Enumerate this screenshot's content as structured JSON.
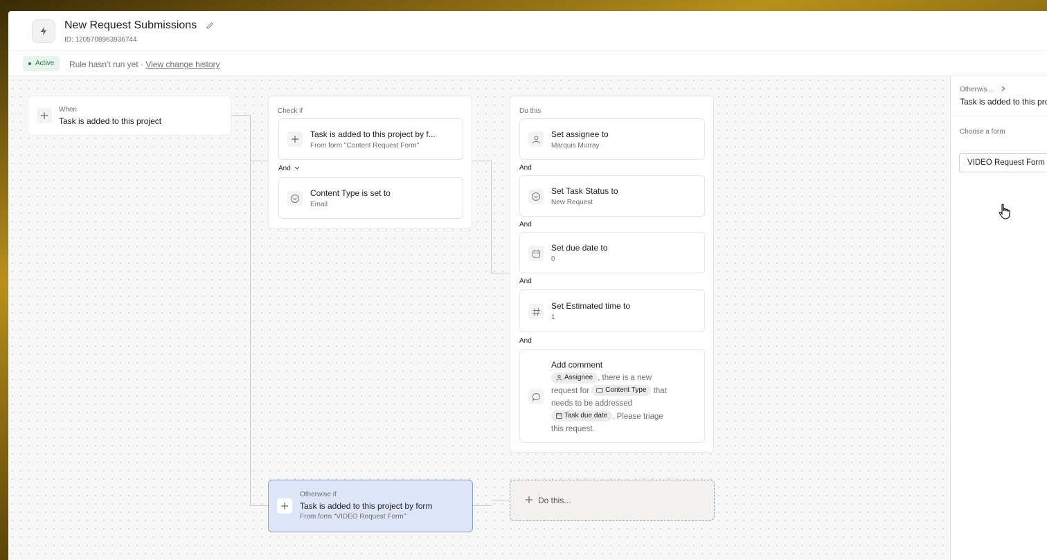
{
  "header": {
    "title": "New Request Submissions",
    "id_text": "ID: 1205708963936744"
  },
  "status": {
    "badge": "Active",
    "run_text": "Rule hasn't run yet · ",
    "history_link": "View change history"
  },
  "when": {
    "label": "When",
    "trigger": "Task is added to this project"
  },
  "check_if": {
    "label": "Check if",
    "conditions": [
      {
        "title": "Task is added to this project by f...",
        "subtitle": "From form \"Content Request Form\""
      },
      {
        "title": "Content Type is set to",
        "subtitle": "Email"
      }
    ],
    "and_label": "And"
  },
  "do_this": {
    "label": "Do this",
    "and_label": "And",
    "actions": [
      {
        "title": "Set assignee to",
        "subtitle": "Marquis Murray",
        "icon": "person-icon"
      },
      {
        "title": "Set Task Status to",
        "subtitle": "New Request",
        "icon": "dropdown-circle-icon"
      },
      {
        "title": "Set due date to",
        "subtitle": "0",
        "icon": "calendar-icon"
      },
      {
        "title": "Set Estimated time to",
        "subtitle": "1",
        "icon": "hash-icon"
      }
    ],
    "comment": {
      "title": "Add comment",
      "chip_assignee": "Assignee",
      "text1": ", there is a new request for ",
      "chip_content_type": "Content Type",
      "text2": " that needs to be addressed ",
      "chip_due": "Task due date",
      "text3": ". Please triage this request."
    }
  },
  "otherwise": {
    "label": "Otherwise if",
    "title": "Task is added to this project by form",
    "subtitle": "From form \"VIDEO Request Form\"",
    "do_this": "Do this..."
  },
  "side_panel": {
    "breadcrumb": "Otherwis...",
    "title": "Task is added to this pro",
    "choose_label": "Choose a form",
    "form_value": "VIDEO Request Form"
  },
  "colors": {
    "accent_selected": "#dfe5f8",
    "active_green": "#2b7a4b"
  }
}
